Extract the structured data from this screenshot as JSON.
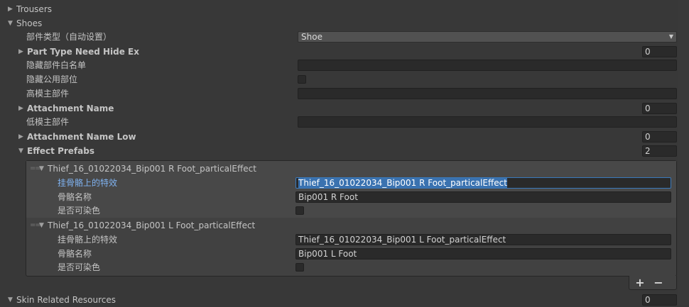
{
  "trousers": {
    "label": "Trousers"
  },
  "shoes": {
    "label": "Shoes",
    "part_type": {
      "label": "部件类型（自动设置）",
      "value": "Shoe"
    },
    "part_type_need_hide_ex": {
      "label": "Part Type Need Hide Ex",
      "count": "0"
    },
    "hide_part_whitelist": {
      "label": "隐藏部件白名单",
      "value": ""
    },
    "hide_common_part": {
      "label": "隐藏公用部位"
    },
    "high_main_part": {
      "label": "高模主部件",
      "value": ""
    },
    "attachment_name": {
      "label": "Attachment Name",
      "count": "0"
    },
    "low_main_part": {
      "label": "低模主部件",
      "value": ""
    },
    "attachment_name_low": {
      "label": "Attachment Name Low",
      "count": "0"
    },
    "effect_prefabs": {
      "label": "Effect Prefabs",
      "count": "2",
      "items": [
        {
          "title": "Thief_16_01022034_Bip001 R Foot_particalEffect",
          "effect_label": "挂骨骼上的特效",
          "effect_value": "Thief_16_01022034_Bip001 R Foot_particalEffect",
          "bone_label": "骨骼名称",
          "bone_value": "Bip001 R Foot",
          "dyeable_label": "是否可染色"
        },
        {
          "title": "Thief_16_01022034_Bip001 L Foot_particalEffect",
          "effect_label": "挂骨骼上的特效",
          "effect_value": "Thief_16_01022034_Bip001 L Foot_particalEffect",
          "bone_label": "骨骼名称",
          "bone_value": "Bip001 L Foot",
          "dyeable_label": "是否可染色"
        }
      ],
      "add_label": "+",
      "remove_label": "−"
    }
  },
  "skin_related_resources": {
    "label": "Skin Related Resources",
    "count": "0"
  },
  "icons": {
    "collapsed": "triangle-right",
    "expanded": "triangle-down",
    "dropdown": "triangle-down"
  },
  "colors": {
    "background": "#383838",
    "field": "#2a2a2a",
    "selection": "#3a72b0",
    "focus_label": "#7fb2f0"
  }
}
